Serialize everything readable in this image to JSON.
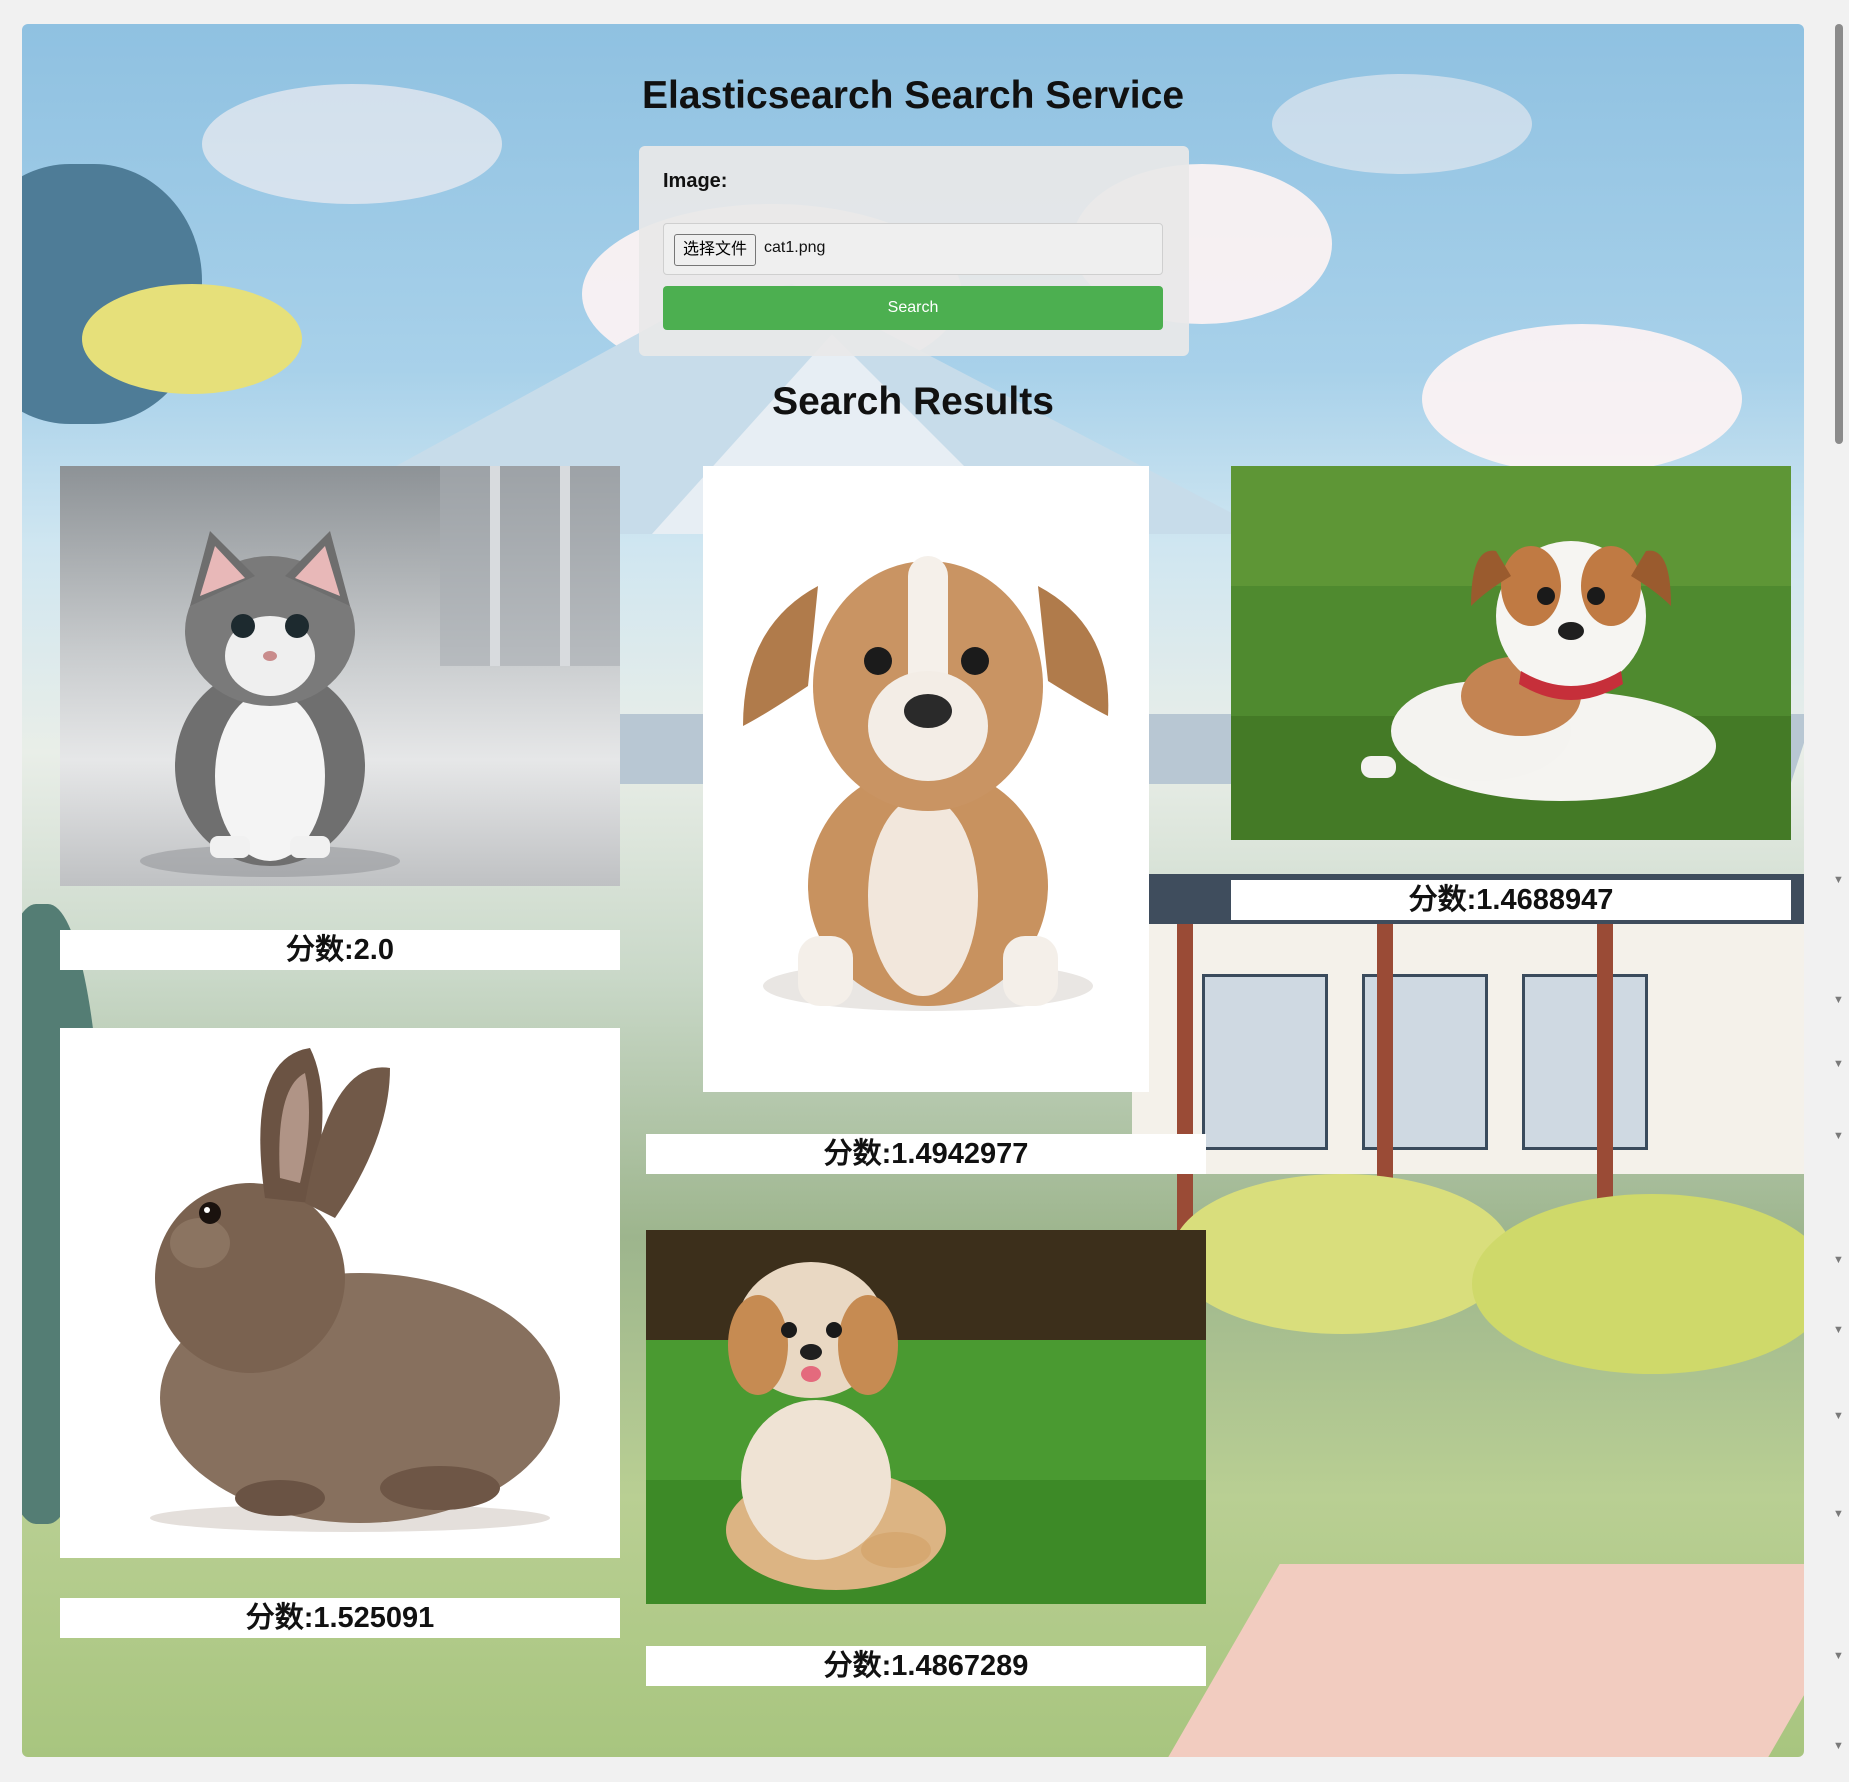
{
  "header": {
    "title": "Elasticsearch Search Service"
  },
  "form": {
    "image_label": "Image:",
    "file_button_label": "选择文件",
    "file_name": "cat1.png",
    "search_label": "Search"
  },
  "results": {
    "title": "Search Results",
    "items": [
      {
        "subject": "kitten",
        "score": "分数:2.0"
      },
      {
        "subject": "puppy-white-background",
        "score": "分数:1.4942977"
      },
      {
        "subject": "puppy-on-grass-red-collar",
        "score": "分数:1.4688947"
      },
      {
        "subject": "rabbit",
        "score": "分数:1.525091"
      },
      {
        "subject": "fluffy-puppy-on-grass",
        "score": "分数:1.4867289"
      }
    ]
  }
}
